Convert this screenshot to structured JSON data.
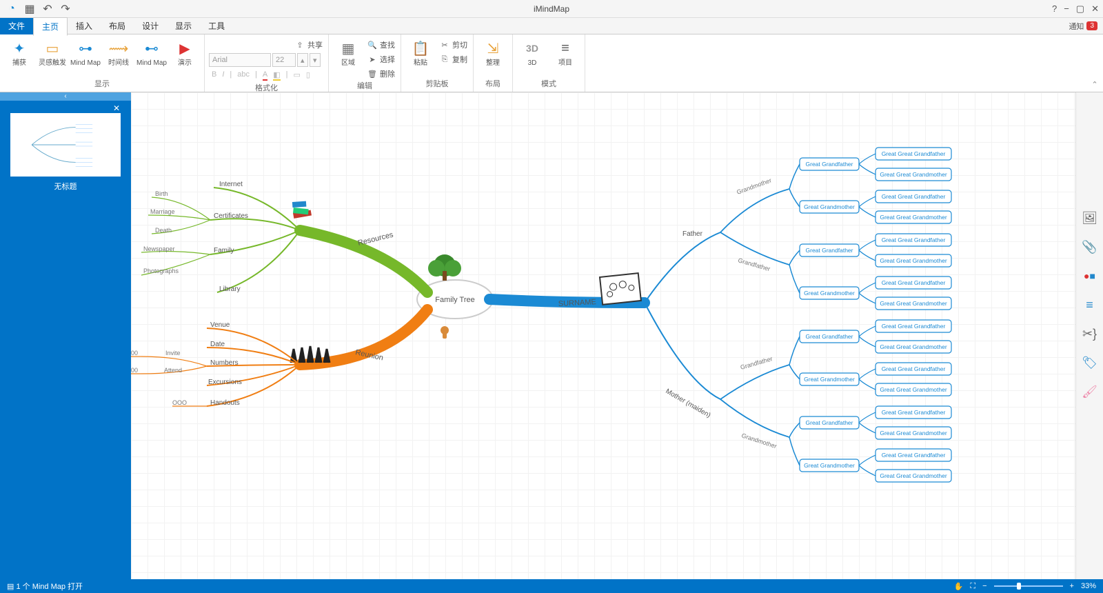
{
  "title": "iMindMap",
  "menu": {
    "file": "文件",
    "home": "主页",
    "insert": "插入",
    "layout": "布局",
    "design": "设计",
    "view": "显示",
    "tool": "工具",
    "notify": "通知",
    "badge": "3"
  },
  "ribbon": {
    "groups": {
      "display": {
        "label": "显示",
        "capture": "捕获",
        "inspire": "灵感触发",
        "mindmap": "Mind Map",
        "timeline": "时间线",
        "mindmap2": "Mind Map",
        "present": "演示"
      },
      "format": {
        "label": "格式化",
        "font": "Arial",
        "size": "22"
      },
      "edit": {
        "label": "编辑",
        "region": "区域",
        "find": "查找",
        "select": "选择",
        "delete": "删除"
      },
      "clip": {
        "label": "剪贴板",
        "paste": "粘贴",
        "cut": "剪切",
        "copy": "复制"
      },
      "layout2": {
        "label": "布局",
        "tidy": "整理"
      },
      "mode": {
        "label": "模式",
        "threed": "3D",
        "project": "项目"
      },
      "share": "共享"
    }
  },
  "sidebar": {
    "thumb_title": "无标题"
  },
  "map": {
    "center": "Family Tree",
    "resources": {
      "label": "Resources",
      "internet": "Internet",
      "certificates": "Certificates",
      "family": "Family",
      "library": "Library",
      "birth": "Birth",
      "marriage": "Marriage",
      "death": "Death",
      "newspaper": "Newspaper",
      "photographs": "Photographs"
    },
    "reunion": {
      "label": "Reunion",
      "venue": "Venue",
      "date": "Date",
      "numbers": "Numbers",
      "excursions": "Excursions",
      "handouts": "Handouts",
      "invite": "Invite",
      "attend": "Attend",
      "ooo": "OOO"
    },
    "surname": {
      "label": "SURNAME",
      "father": "Father",
      "mother": "Mother (maiden)",
      "grandmother": "Grandmother",
      "grandfather": "Grandfather",
      "ggf": "Great Grandfather",
      "ggm": "Great Grandmother",
      "gggf": "Great Great Grandfather",
      "gggm": "Great Great Grandmother"
    }
  },
  "status": {
    "left": "1 个 Mind Map 打开",
    "zoom": "33%"
  }
}
